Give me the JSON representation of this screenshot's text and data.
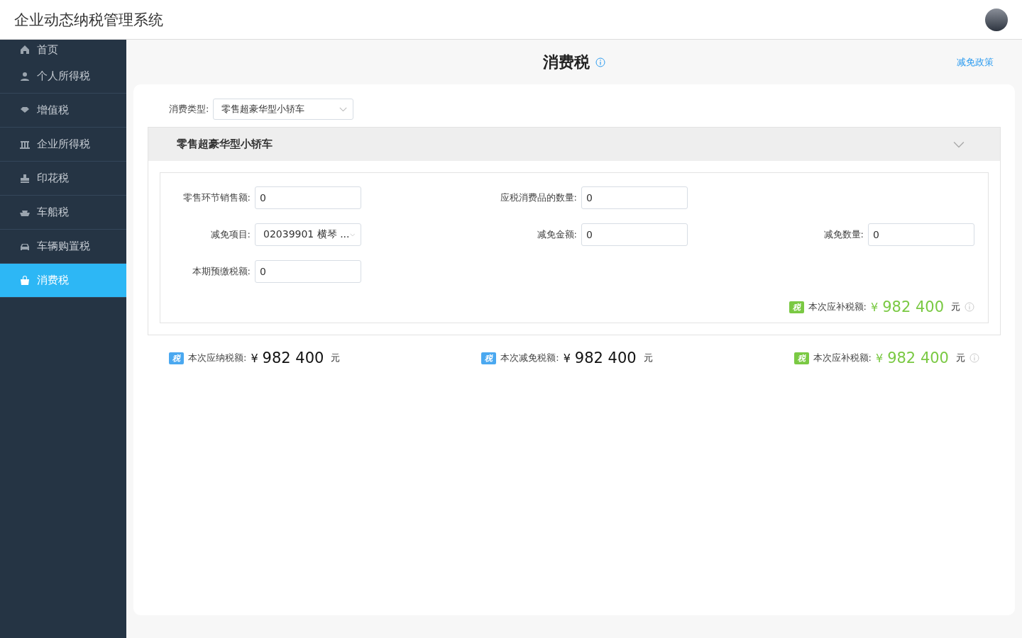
{
  "app": {
    "title": "企业动态纳税管理系统"
  },
  "sidebar": {
    "items": [
      {
        "label": "首页",
        "selected": false
      },
      {
        "label": "个人所得税",
        "selected": false
      },
      {
        "label": "增值税",
        "selected": false
      },
      {
        "label": "企业所得税",
        "selected": false
      },
      {
        "label": "印花税",
        "selected": false
      },
      {
        "label": "车船税",
        "selected": false
      },
      {
        "label": "车辆购置税",
        "selected": false
      },
      {
        "label": "消费税",
        "selected": true
      }
    ]
  },
  "page": {
    "title": "消费税",
    "link": "减免政策"
  },
  "type_select": {
    "label": "消费类型:",
    "value": "零售超豪华型小轿车"
  },
  "section": {
    "title": "零售超豪华型小轿车",
    "expanded": true,
    "rows": [
      [
        {
          "kind": "input",
          "label": "零售环节销售额:",
          "value": "0"
        },
        {
          "kind": "input",
          "label": "应税消费品的数量:",
          "value": "0"
        }
      ],
      [
        {
          "kind": "select",
          "label": "减免项目:",
          "value": "02039901 横琴 ..."
        },
        {
          "kind": "input",
          "label": "减免金额:",
          "value": "0"
        },
        {
          "kind": "input",
          "label": "减免数量:",
          "value": "0"
        }
      ],
      [
        {
          "kind": "input",
          "label": "本期预缴税额:",
          "value": "0"
        }
      ]
    ],
    "total": {
      "badge": "税",
      "color": "#7ac943",
      "label": "本次应补税额:",
      "currency": "¥",
      "amount": "982 400",
      "unit": "元",
      "highlight": true,
      "info": true
    }
  },
  "summary": [
    {
      "badge": "税",
      "color": "#4aa8f0",
      "label": "本次应纳税额:",
      "currency": "¥",
      "amount": "982 400",
      "unit": "元",
      "highlight": false,
      "info": false
    },
    {
      "badge": "税",
      "color": "#4aa8f0",
      "label": "本次减免税额:",
      "currency": "¥",
      "amount": "982 400",
      "unit": "元",
      "highlight": false,
      "info": false
    },
    {
      "badge": "税",
      "color": "#7ac943",
      "label": "本次应补税额:",
      "currency": "¥",
      "amount": "982 400",
      "unit": "元",
      "highlight": true,
      "info": true
    }
  ]
}
